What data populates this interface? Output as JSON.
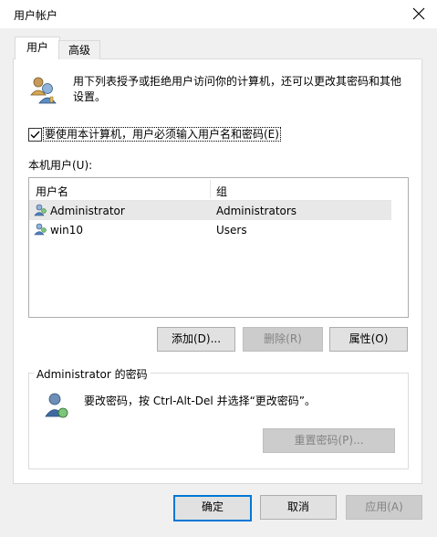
{
  "window": {
    "title": "用户帐户"
  },
  "tabs": [
    {
      "label": "用户",
      "active": true
    },
    {
      "label": "高级",
      "active": false
    }
  ],
  "description": "用下列表授予或拒绝用户访问你的计算机，还可以更改其密码和其他设置。",
  "must_login_checkbox": {
    "label": "要使用本计算机，用户必须输入用户名和密码(E)",
    "checked": true
  },
  "local_users_label": "本机用户(U):",
  "users_table": {
    "columns": [
      "用户名",
      "组"
    ],
    "rows": [
      {
        "name": "Administrator",
        "group": "Administrators",
        "selected": true
      },
      {
        "name": "win10",
        "group": "Users",
        "selected": false
      }
    ]
  },
  "buttons": {
    "add": "添加(D)...",
    "remove": "删除(R)",
    "properties": "属性(O)",
    "reset_password": "重置密码(P)...",
    "ok": "确定",
    "cancel": "取消",
    "apply": "应用(A)"
  },
  "password_group": {
    "title": "Administrator 的密码",
    "hint": "要改密码，按 Ctrl-Alt-Del 并选择“更改密码”。"
  },
  "icons": [
    "users-icon",
    "user-icon",
    "close-icon",
    "checkmark-icon"
  ],
  "colors": {
    "accent": "#0078d7",
    "selected_row": "#e8e8e8"
  }
}
